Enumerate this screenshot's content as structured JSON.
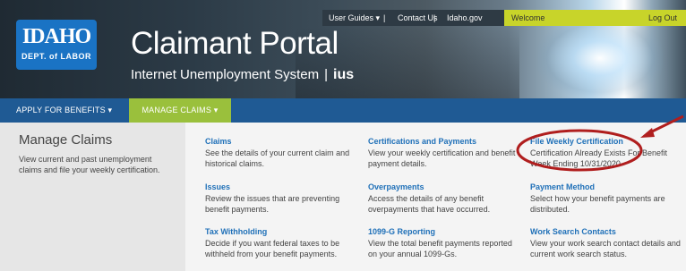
{
  "header": {
    "logo": {
      "line1": "IDAHO",
      "line2": "DEPT. of LABOR"
    },
    "title": "Claimant Portal",
    "subtitle": "Internet Unemployment System",
    "subtitle_sep": "|",
    "system_logo": "ius"
  },
  "utility_nav": {
    "user_guides": "User Guides ▾",
    "divider": "|",
    "contact_us": "Contact Us",
    "idaho_gov": "Idaho.gov",
    "welcome": "Welcome",
    "logout": "Log Out"
  },
  "main_nav": {
    "apply": "APPLY FOR BENEFITS ▾",
    "manage": "MANAGE CLAIMS ▾"
  },
  "sidebar": {
    "title": "Manage Claims",
    "description": "View current and past unemployment claims and file your weekly certification."
  },
  "cards": [
    {
      "title": "Claims",
      "desc": "See the details of your current claim and historical claims."
    },
    {
      "title": "Certifications and Payments",
      "desc": "View your weekly certification and benefit payment details."
    },
    {
      "title": "File Weekly Certification",
      "desc": "Certification Already Exists For Benefit Week Ending 10/31/2020"
    },
    {
      "title": "Issues",
      "desc": "Review the issues that are preventing benefit payments."
    },
    {
      "title": "Overpayments",
      "desc": "Access the details of any benefit overpayments that have occurred."
    },
    {
      "title": "Payment Method",
      "desc": "Select how your benefit payments are distributed."
    },
    {
      "title": "Tax Withholding",
      "desc": "Decide if you want federal taxes to be withheld from your benefit payments."
    },
    {
      "title": "1099-G Reporting",
      "desc": "View the total benefit payments reported on your annual 1099-Gs."
    },
    {
      "title": "Work Search Contacts",
      "desc": "View your work search contact details and current work search status."
    }
  ],
  "colors": {
    "nav_blue": "#1f5a94",
    "manage_tab_green": "#9ac03c",
    "link_blue": "#1f70b8",
    "welcome_bar": "#c8d42a",
    "annotation_red": "#b01e1e"
  }
}
